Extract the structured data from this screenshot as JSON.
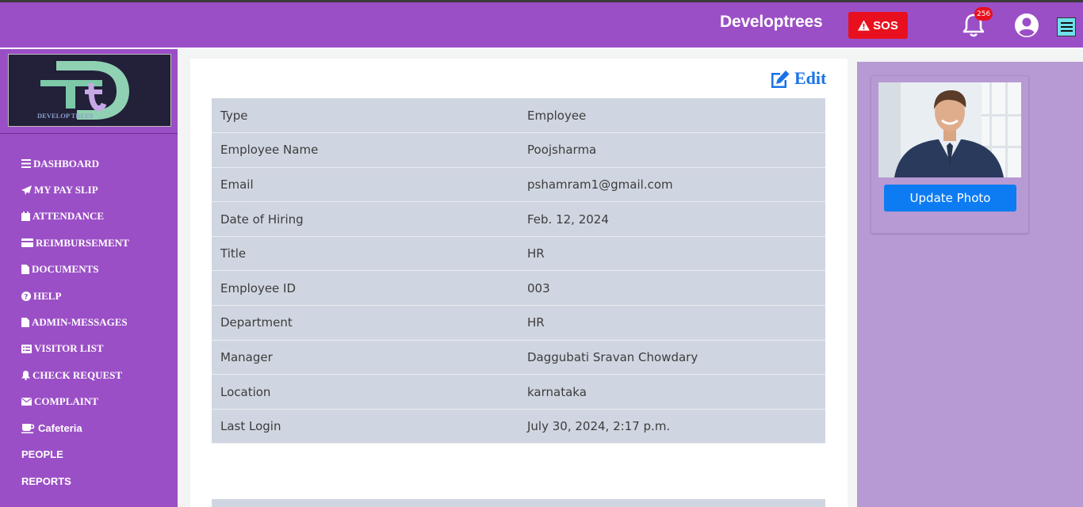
{
  "header": {
    "brand": "Developtrees",
    "sos_label": "SOS",
    "notification_count": "256",
    "colors": {
      "bar": "#9b4fc6",
      "sos": "#e8101e"
    }
  },
  "sidebar": {
    "logo_text": "DEVELOP TREES",
    "items": [
      {
        "label": "DASHBOARD",
        "icon": "bars-icon"
      },
      {
        "label": "MY PAY SLIP",
        "icon": "paper-plane-icon"
      },
      {
        "label": "ATTENDANCE",
        "icon": "calendar-icon"
      },
      {
        "label": "REIMBURSEMENT",
        "icon": "credit-card-icon"
      },
      {
        "label": "DOCUMENTS",
        "icon": "file-icon"
      },
      {
        "label": "HELP",
        "icon": "question-circle-icon"
      },
      {
        "label": "ADMIN-MESSAGES",
        "icon": "file-icon"
      },
      {
        "label": "VISITOR LIST",
        "icon": "list-icon"
      },
      {
        "label": "CHECK REQUEST",
        "icon": "bell-icon"
      },
      {
        "label": "COMPLAINT",
        "icon": "envelope-icon"
      },
      {
        "label": "Cafeteria",
        "icon": "coffee-icon"
      },
      {
        "label": "PEOPLE",
        "icon": ""
      },
      {
        "label": "REPORTS",
        "icon": ""
      }
    ]
  },
  "profile": {
    "edit_label": "Edit",
    "rows": [
      {
        "key": "Type",
        "value": "Employee"
      },
      {
        "key": "Employee Name",
        "value": "Poojsharma"
      },
      {
        "key": "Email",
        "value": "pshamram1@gmail.com"
      },
      {
        "key": "Date of Hiring",
        "value": "Feb. 12, 2024"
      },
      {
        "key": "Title",
        "value": "HR"
      },
      {
        "key": "Employee ID",
        "value": "003"
      },
      {
        "key": "Department",
        "value": "HR"
      },
      {
        "key": "Manager",
        "value": "Daggubati Sravan Chowdary"
      },
      {
        "key": "Location",
        "value": "karnataka"
      },
      {
        "key": "Last Login",
        "value": "July 30, 2024, 2:17 p.m."
      }
    ]
  },
  "photo_panel": {
    "update_label": "Update Photo",
    "accent": "#0d7cf2"
  }
}
